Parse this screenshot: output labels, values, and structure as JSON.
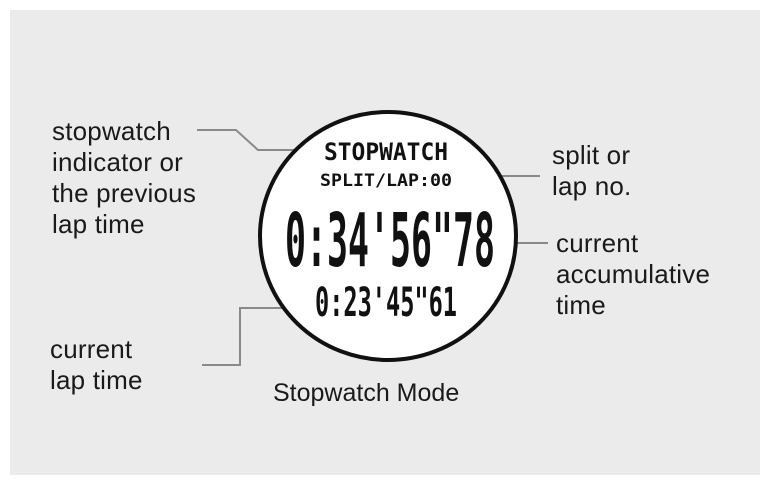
{
  "watch": {
    "mode_indicator": "STOPWATCH",
    "split_lap": "SPLIT/LAP:00",
    "main_time": "0:34'56\"78",
    "lap_time": "0:23'45\"61"
  },
  "labels": {
    "stopwatch_indicator": "stopwatch\nindicator or\nthe previous\nlap time",
    "split_lap_no": "split or\nlap no.",
    "current_accumulative_time": "current\naccumulative\ntime",
    "current_lap_time": "current\nlap time"
  },
  "caption": "Stopwatch Mode",
  "colors": {
    "panel_bg": "#ebebeb",
    "page_bg": "#ffffff",
    "ink": "#111111",
    "connector": "#8a8a8a"
  }
}
